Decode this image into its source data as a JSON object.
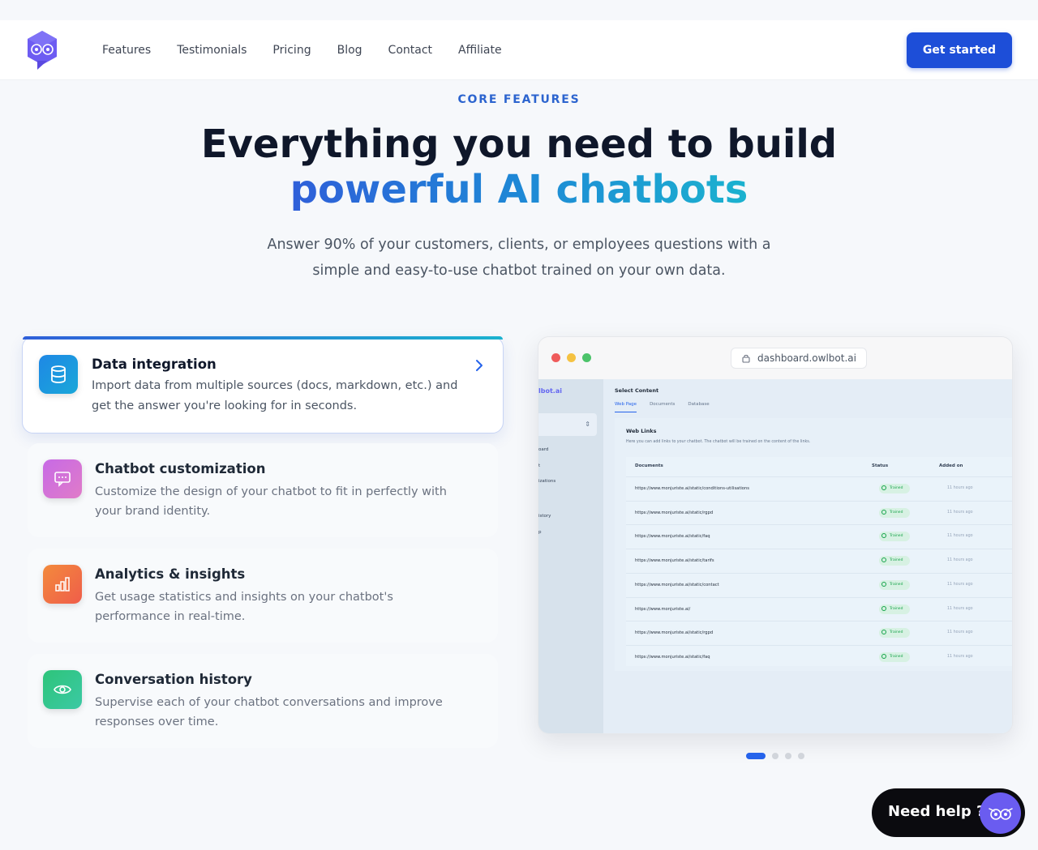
{
  "header": {
    "nav": [
      "Features",
      "Testimonials",
      "Pricing",
      "Blog",
      "Contact",
      "Affiliate"
    ],
    "cta_label": "Get started"
  },
  "hero": {
    "eyebrow": "CORE FEATURES",
    "title_line1": "Everything you need to build",
    "title_line2": "powerful AI chatbots",
    "subtitle_line1": "Answer 90% of your customers, clients, or employees questions with a",
    "subtitle_line2": "simple and easy-to-use chatbot trained on your own data."
  },
  "features": [
    {
      "title": "Data integration",
      "desc": "Import data from multiple sources (docs, markdown, etc.) and get the answer you're looking for in seconds.",
      "icon": "database-icon",
      "color": "#1e88e5"
    },
    {
      "title": "Chatbot customization",
      "desc": "Customize the design of your chatbot to fit in perfectly with your brand identity.",
      "icon": "chat-icon",
      "color": "#d16ee0"
    },
    {
      "title": "Analytics & insights",
      "desc": "Get usage statistics and insights on your chatbot's performance in real-time.",
      "icon": "bar-chart-icon",
      "color": "#f0723c"
    },
    {
      "title": "Conversation history",
      "desc": "Supervise each of your chatbot conversations and improve responses over time.",
      "icon": "eye-icon",
      "color": "#2ec47a"
    }
  ],
  "browser": {
    "url": "dashboard.owlbot.ai",
    "app": {
      "brand": "lbot.ai",
      "sidebar_items": [
        "oard",
        "t",
        "izations",
        "istory",
        "p"
      ],
      "page_title": "Select Content",
      "tabs": [
        "Web Page",
        "Documents",
        "Database"
      ],
      "section_title": "Web Links",
      "section_desc": "Here you can add links to your chatbot. The chatbot will be trained on the content of the links.",
      "columns": [
        "Documents",
        "Status",
        "Added on"
      ],
      "rows": [
        {
          "url": "https://www.monjuriste.ai/static/conditions-utilisations",
          "status": "Trained",
          "added": "11 hours ago"
        },
        {
          "url": "https://www.monjuriste.ai/static/rgpd",
          "status": "Trained",
          "added": "11 hours ago"
        },
        {
          "url": "https://www.monjuriste.ai/static/faq",
          "status": "Trained",
          "added": "11 hours ago"
        },
        {
          "url": "https://www.monjuriste.ai/static/tarifs",
          "status": "Trained",
          "added": "11 hours ago"
        },
        {
          "url": "https://www.monjuriste.ai/static/contact",
          "status": "Trained",
          "added": "11 hours ago"
        },
        {
          "url": "https://www.monjuriste.ai/",
          "status": "Trained",
          "added": "11 hours ago"
        },
        {
          "url": "https://www.monjuriste.ai/static/rgpd",
          "status": "Trained",
          "added": "11 hours ago"
        },
        {
          "url": "https://www.monjuriste.ai/static/faq",
          "status": "Trained",
          "added": "11 hours ago"
        }
      ]
    }
  },
  "pager": {
    "count": 4,
    "active": 1
  },
  "help": {
    "label": "Need help ?"
  },
  "colors": {
    "primary": "#1d4ed8",
    "accent_gradient_start": "#2f5fd9",
    "accent_gradient_end": "#1bb2cf"
  }
}
